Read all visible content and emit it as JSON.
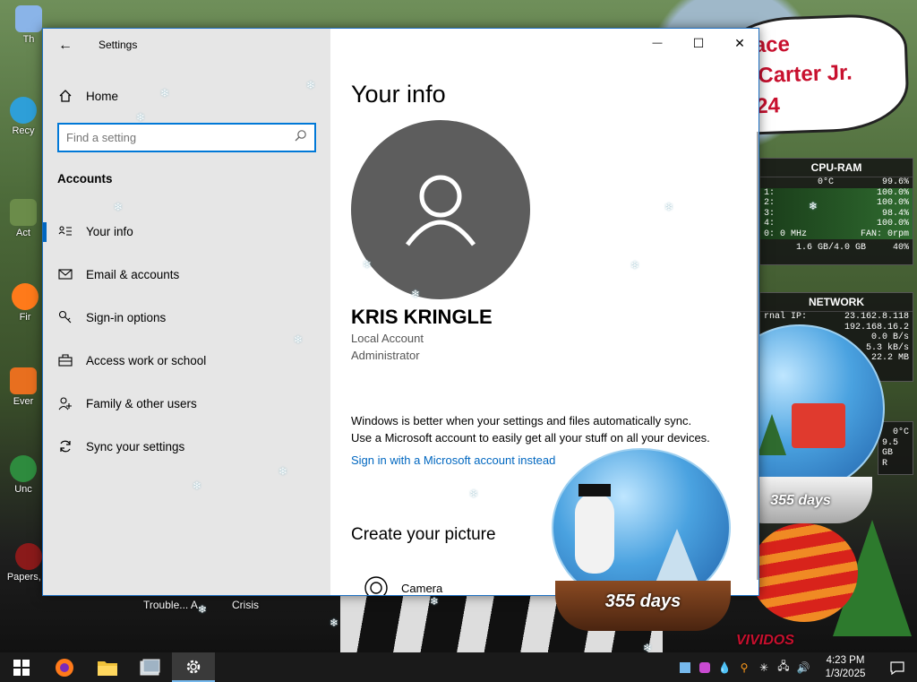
{
  "window": {
    "app_title": "Settings",
    "back_label": "←",
    "minimize": "—",
    "maximize": "☐",
    "close": "✕"
  },
  "sidebar": {
    "home_label": "Home",
    "search_placeholder": "Find a setting",
    "section_label": "Accounts",
    "items": [
      {
        "label": "Your info",
        "icon": "person-card-icon",
        "active": true
      },
      {
        "label": "Email & accounts",
        "icon": "mail-icon",
        "active": false
      },
      {
        "label": "Sign-in options",
        "icon": "key-icon",
        "active": false
      },
      {
        "label": "Access work or school",
        "icon": "briefcase-icon",
        "active": false
      },
      {
        "label": "Family & other users",
        "icon": "person-add-icon",
        "active": false
      },
      {
        "label": "Sync your settings",
        "icon": "sync-icon",
        "active": false
      }
    ]
  },
  "content": {
    "page_title": "Your info",
    "user_name": "KRIS KRINGLE",
    "account_type": "Local Account",
    "role": "Administrator",
    "promo_line1": "Windows is better when your settings and files automatically sync.",
    "promo_line2": "Use a Microsoft account to easily get all your stuff on all your devices.",
    "sign_in_link": "Sign in with a Microsoft account instead",
    "create_picture_heading": "Create your picture",
    "camera_label": "Camera"
  },
  "desktop": {
    "banner_lines": [
      "ace",
      "l Carter Jr.",
      "24"
    ],
    "icon_labels": [
      "Th",
      "Recy",
      "Act",
      "Fir",
      "Ever",
      "Unc",
      "Papers, P"
    ],
    "taskbar_window_labels": [
      "Trouble... A...",
      "Crisis"
    ],
    "watermark": "VIVIDOS"
  },
  "gadgets": {
    "cpu": {
      "title": "CPU-RAM",
      "temp": "0°C",
      "total": "99.6%",
      "cores": [
        {
          "n": "1:",
          "v": "100.0%"
        },
        {
          "n": "2:",
          "v": "100.0%"
        },
        {
          "n": "3:",
          "v": "98.4%"
        },
        {
          "n": "4:",
          "v": "100.0%"
        }
      ],
      "freq": "0: 0 MHz",
      "fan": "FAN: 0rpm",
      "ram": "1.6 GB/4.0 GB",
      "ram_pct": "40%"
    },
    "network": {
      "title": "NETWORK",
      "ext_label": "rnal IP:",
      "ext_ip": "23.162.8.118",
      "int_ip": "192.168.16.2",
      "up": "0.0 B/s",
      "down": "5.3 kB/s",
      "total": "22.2 MB"
    },
    "hdd": {
      "temp": "0°C",
      "free": "9.5 GB",
      "letter": "R"
    }
  },
  "globes": [
    {
      "label": "355 days"
    },
    {
      "label": "355 days"
    }
  ],
  "taskbar": {
    "time": "4:23 PM",
    "date": "1/3/2025"
  }
}
